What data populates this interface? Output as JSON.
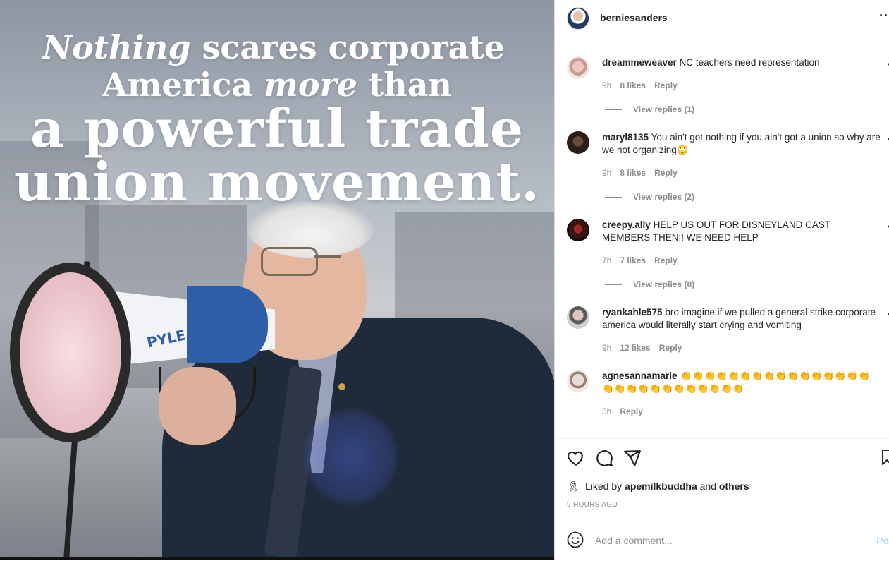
{
  "post_image": {
    "headline": {
      "line1_italic": "Nothing",
      "line1_rest": " scares corporate",
      "line2_start": "America ",
      "line2_italic": "more",
      "line2_end": " than",
      "line3": "a powerful trade",
      "line4": "union movement."
    },
    "megaphone_brand": "PYLE"
  },
  "header": {
    "username": "berniesanders",
    "more": "··"
  },
  "comments": [
    {
      "user": "dreammeweaver",
      "text": "NC teachers need representation",
      "time": "9h",
      "likes": "8 likes",
      "reply": "Reply",
      "view_replies": "View replies (1)"
    },
    {
      "user": "maryl8135",
      "text": "You ain't got nothing if you ain't got a union so why are we not organizing🙄",
      "time": "9h",
      "likes": "8 likes",
      "reply": "Reply",
      "view_replies": "View replies (2)"
    },
    {
      "user": "creepy.ally",
      "text": "HELP US OUT FOR DISNEYLAND CAST MEMBERS THEN!! WE NEED HELP",
      "time": "7h",
      "likes": "7 likes",
      "reply": "Reply",
      "view_replies": "View replies (8)"
    },
    {
      "user": "ryankahle575",
      "text": "bro imagine if we pulled a general strike corporate america would literally start crying and vomiting",
      "time": "9h",
      "likes": "12 likes",
      "reply": "Reply"
    },
    {
      "user": "agnesannamarie",
      "text": "👏👏👏👏👏👏👏👏👏👏👏👏👏👏👏👏👏👏👏👏👏👏👏👏👏👏👏👏",
      "time": "5h",
      "reply": "Reply"
    }
  ],
  "actions": {
    "liked_by_prefix": "Liked by",
    "liked_by_user": "apemilkbuddha",
    "liked_by_and": "and",
    "liked_by_others": "others",
    "time_ago": "9 HOURS AGO"
  },
  "comment_box": {
    "placeholder": "Add a comment...",
    "post_label": "Pos"
  }
}
